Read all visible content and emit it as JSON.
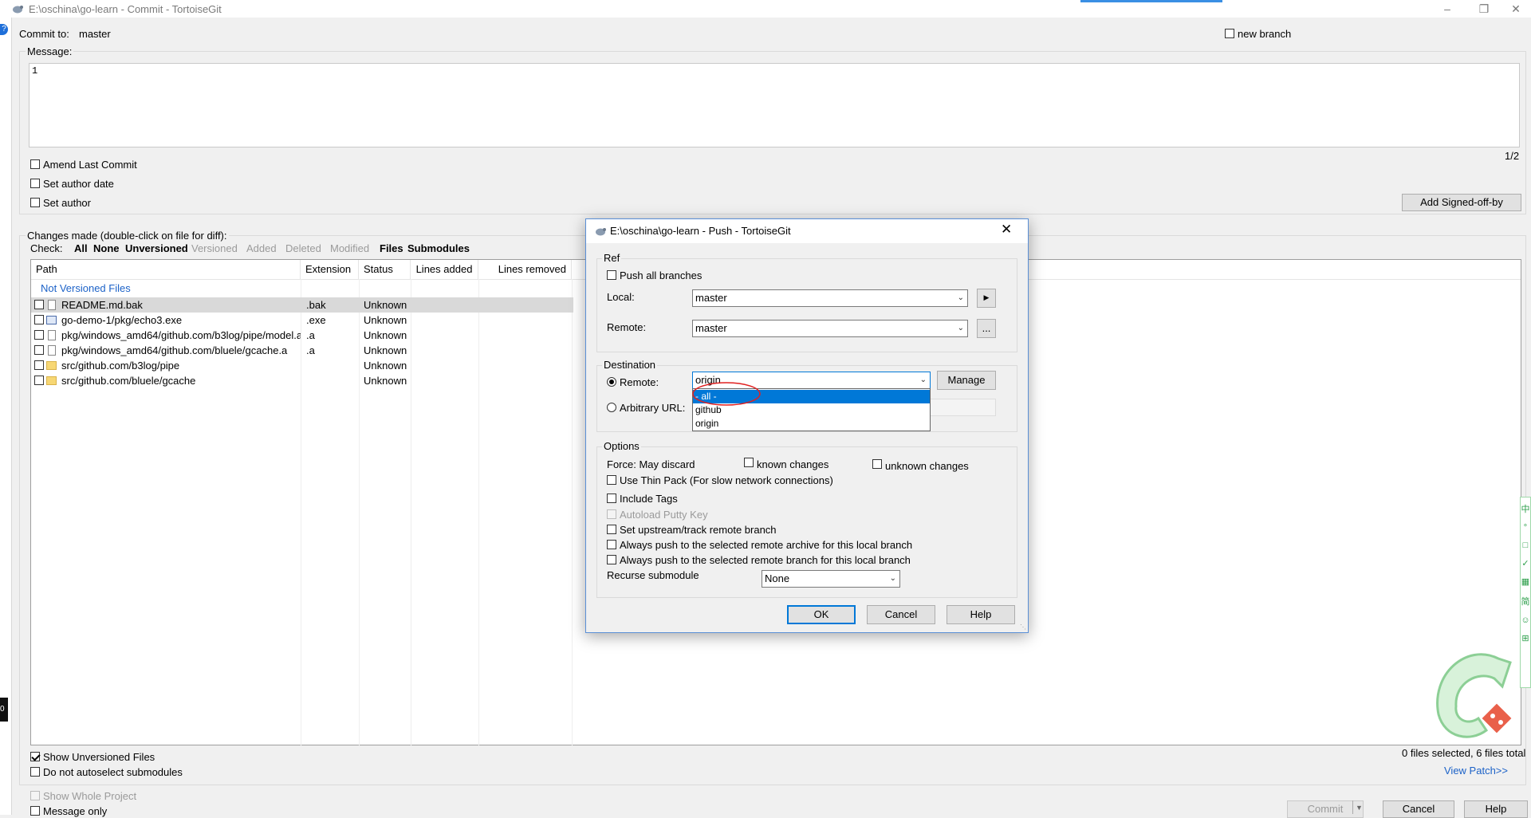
{
  "window": {
    "title": "E:\\oschina\\go-learn - Commit - TortoiseGit",
    "help_badge": "?",
    "left_chip": "0"
  },
  "commit": {
    "commit_to_label": "Commit to:",
    "branch": "master",
    "new_branch_label": "new branch",
    "new_branch_checked": false,
    "message_label": "Message:",
    "message_value": "1",
    "page_counter": "1/2",
    "amend_label": "Amend Last Commit",
    "set_author_date_label": "Set author date",
    "set_author_label": "Set author",
    "signed_off_button": "Add Signed-off-by"
  },
  "changes": {
    "header": "Changes made (double-click on file for diff):",
    "check_label": "Check:",
    "filters": [
      {
        "label": "All",
        "active": true
      },
      {
        "label": "None",
        "active": true
      },
      {
        "label": "Unversioned",
        "active": true
      },
      {
        "label": "Versioned",
        "active": false
      },
      {
        "label": "Added",
        "active": false
      },
      {
        "label": "Deleted",
        "active": false
      },
      {
        "label": "Modified",
        "active": false
      },
      {
        "label": "Files",
        "active": true
      },
      {
        "label": "Submodules",
        "active": true
      }
    ],
    "columns": [
      "Path",
      "Extension",
      "Status",
      "Lines added",
      "Lines removed"
    ],
    "group_label": "Not Versioned Files",
    "rows": [
      {
        "path": "README.md.bak",
        "ext": ".bak",
        "status": "Unknown",
        "icon": "file-icon"
      },
      {
        "path": "go-demo-1/pkg/echo3.exe",
        "ext": ".exe",
        "status": "Unknown",
        "icon": "exe-icon"
      },
      {
        "path": "pkg/windows_amd64/github.com/b3log/pipe/model.a",
        "ext": ".a",
        "status": "Unknown",
        "icon": "file-icon"
      },
      {
        "path": "pkg/windows_amd64/github.com/bluele/gcache.a",
        "ext": ".a",
        "status": "Unknown",
        "icon": "file-icon"
      },
      {
        "path": "src/github.com/b3log/pipe",
        "ext": "",
        "status": "Unknown",
        "icon": "folder-icon"
      },
      {
        "path": "src/github.com/bluele/gcache",
        "ext": "",
        "status": "Unknown",
        "icon": "folder-icon"
      }
    ],
    "show_unversioned_label": "Show Unversioned Files",
    "show_unversioned_checked": true,
    "no_autoselect_label": "Do not autoselect submodules",
    "summary": "0 files selected, 6 files total",
    "view_patch": "View Patch>>",
    "show_whole_project_label": "Show Whole Project",
    "message_only_label": "Message only"
  },
  "bottom_buttons": {
    "commit": "Commit",
    "cancel": "Cancel",
    "help": "Help"
  },
  "push_dialog": {
    "title": "E:\\oschina\\go-learn - Push - TortoiseGit",
    "ref_group": "Ref",
    "push_all_branches_label": "Push all branches",
    "local_label": "Local:",
    "local_value": "master",
    "remote_ref_label": "Remote:",
    "remote_ref_value": "master",
    "more_button": "...",
    "destination_group": "Destination",
    "remote_radio_label": "Remote:",
    "remote_value": "origin",
    "manage_button": "Manage",
    "arbitrary_url_label": "Arbitrary URL:",
    "dropdown_options": [
      "- all -",
      "github",
      "origin"
    ],
    "dropdown_selected_index": 0,
    "options_group": "Options",
    "force_label": "Force: May discard",
    "known_changes_label": "known changes",
    "unknown_changes_label": "unknown changes",
    "thin_pack_label": "Use Thin Pack (For slow network connections)",
    "include_tags_label": "Include Tags",
    "autoload_putty_label": "Autoload Putty Key",
    "set_upstream_label": "Set upstream/track remote branch",
    "always_push_archive_label": "Always push to the selected remote archive for this local branch",
    "always_push_branch_label": "Always push to the selected remote branch for this local branch",
    "recurse_label": "Recurse submodule",
    "recurse_value": "None",
    "ok_button": "OK",
    "cancel_button": "Cancel",
    "help_button": "Help"
  },
  "side_widget": {
    "glyphs": [
      "中",
      "°",
      "□",
      "✓",
      "▦",
      "简",
      "☺",
      "⊞"
    ]
  }
}
